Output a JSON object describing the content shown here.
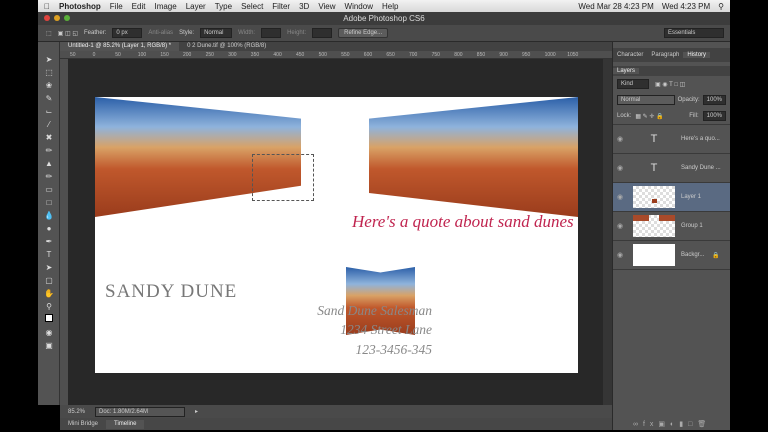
{
  "menubar": {
    "app": "Photoshop",
    "items": [
      "File",
      "Edit",
      "Image",
      "Layer",
      "Type",
      "Select",
      "Filter",
      "3D",
      "View",
      "Window",
      "Help"
    ],
    "clock": "Wed Mar 28  4:23 PM",
    "clock2": "Wed 4:23 PM"
  },
  "window": {
    "title": "Adobe Photoshop CS6"
  },
  "options": {
    "feather_label": "Feather:",
    "feather_value": "0 px",
    "antialias": "Anti-alias",
    "style_label": "Style:",
    "style_value": "Normal",
    "width_label": "Width:",
    "height_label": "Height:",
    "refine": "Refine Edge...",
    "workspace": "Essentials"
  },
  "tabs": [
    {
      "label": "Untitled-1 @ 85.2% (Layer 1, RGB/8) *"
    },
    {
      "label": "0 2 Dune.tif @ 100% (RGB/8)"
    }
  ],
  "ruler": [
    "50",
    "0",
    "50",
    "100",
    "150",
    "200",
    "250",
    "300",
    "350",
    "400",
    "450",
    "500",
    "550",
    "600",
    "650",
    "700",
    "750",
    "800",
    "850",
    "900",
    "950",
    "1000",
    "1050"
  ],
  "document": {
    "quote": "Here's a quote about sand dunes",
    "name": "SANDY DUNE",
    "title": "Sand Dune Salesman",
    "address": "1234 Street Lane",
    "phone": "123-3456-345"
  },
  "status": {
    "zoom": "85.2%",
    "doc": "Doc: 1.80M/2.64M"
  },
  "bottom_tabs": [
    "Mini Bridge",
    "Timeline"
  ],
  "panel": {
    "tabs": [
      "Character",
      "Paragraph",
      "History"
    ],
    "layers_tab": "Layers",
    "kind": "Kind",
    "blend": "Normal",
    "opacity_label": "Opacity:",
    "opacity": "100%",
    "lock_label": "Lock:",
    "fill_label": "Fill:",
    "fill": "100%",
    "layers": [
      {
        "name": "Here's a quo...",
        "type": "text"
      },
      {
        "name": "Sandy Dune ...",
        "type": "text"
      },
      {
        "name": "Layer 1",
        "type": "image",
        "selected": true
      },
      {
        "name": "Group 1",
        "type": "group"
      },
      {
        "name": "Backgr...",
        "type": "background",
        "locked": true
      }
    ]
  },
  "colors": {
    "accent": "#c0244f",
    "selection": "#5a6a82"
  }
}
